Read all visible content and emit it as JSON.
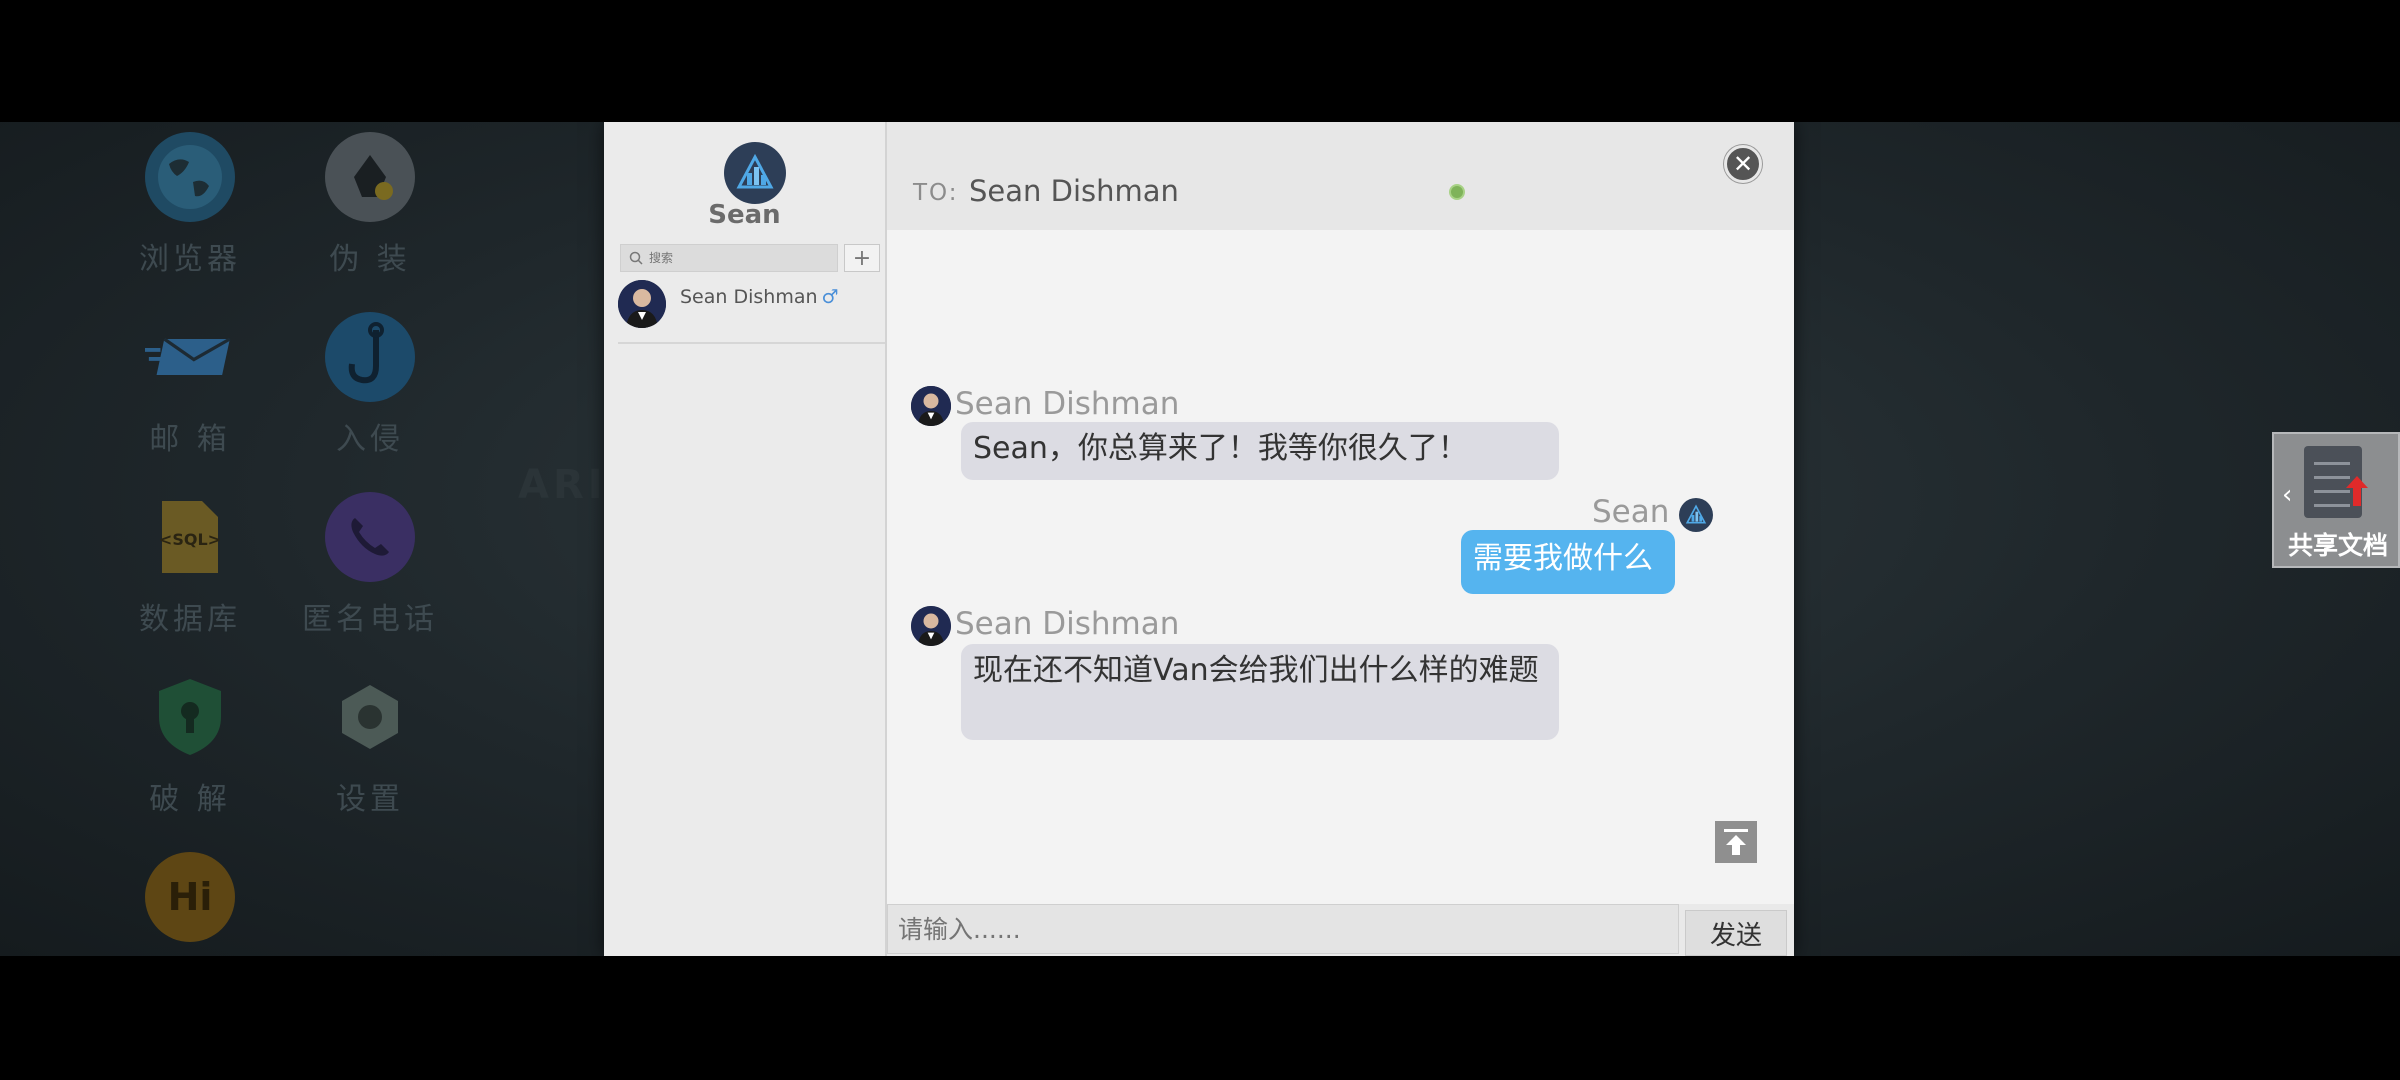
{
  "desktop": {
    "apps": [
      {
        "label": "浏览器",
        "icon": "globe-icon",
        "color": "#2a7fb4"
      },
      {
        "label": "伪 装",
        "icon": "disguise-icon",
        "color": "#cfcfcf"
      },
      {
        "label": "邮 箱",
        "icon": "mail-icon",
        "color": "#3a8fe8"
      },
      {
        "label": "入侵",
        "icon": "hook-icon",
        "color": "#2c7fc0"
      },
      {
        "label": "数据库",
        "icon": "sql-file-icon",
        "color": "#d4a12a"
      },
      {
        "label": "匿名电话",
        "icon": "phone-icon",
        "color": "#6a52c9"
      },
      {
        "label": "破 解",
        "icon": "shield-key-icon",
        "color": "#2f9a5c"
      },
      {
        "label": "设置",
        "icon": "gear-icon",
        "color": "#8fa8a0"
      },
      {
        "label": "",
        "icon": "hi-icon",
        "color": "#e0a020"
      }
    ]
  },
  "sidebar": {
    "user_name": "Sean",
    "search_placeholder": "搜索",
    "add_label": "+",
    "contacts": [
      {
        "name": "Sean Dishman",
        "gender": "♂"
      }
    ]
  },
  "chat": {
    "to_label": "TO:",
    "to_name": "Sean Dishman",
    "close_label": "✕",
    "messages": [
      {
        "from": "Sean Dishman",
        "direction": "in",
        "text": "Sean，你总算来了！我等你很久了！"
      },
      {
        "from": "Sean",
        "direction": "out",
        "text": "需要我做什么"
      },
      {
        "from": "Sean Dishman",
        "direction": "in",
        "text": "现在还不知道Van会给我们出什么样的难题"
      }
    ],
    "input_placeholder": "请输入......",
    "send_label": "发送"
  },
  "share_panel": {
    "label": "共享文档"
  },
  "colors": {
    "outgoing_bubble": "#55b4ef",
    "incoming_bubble": "#dcdce3",
    "online": "#7fb35a"
  }
}
